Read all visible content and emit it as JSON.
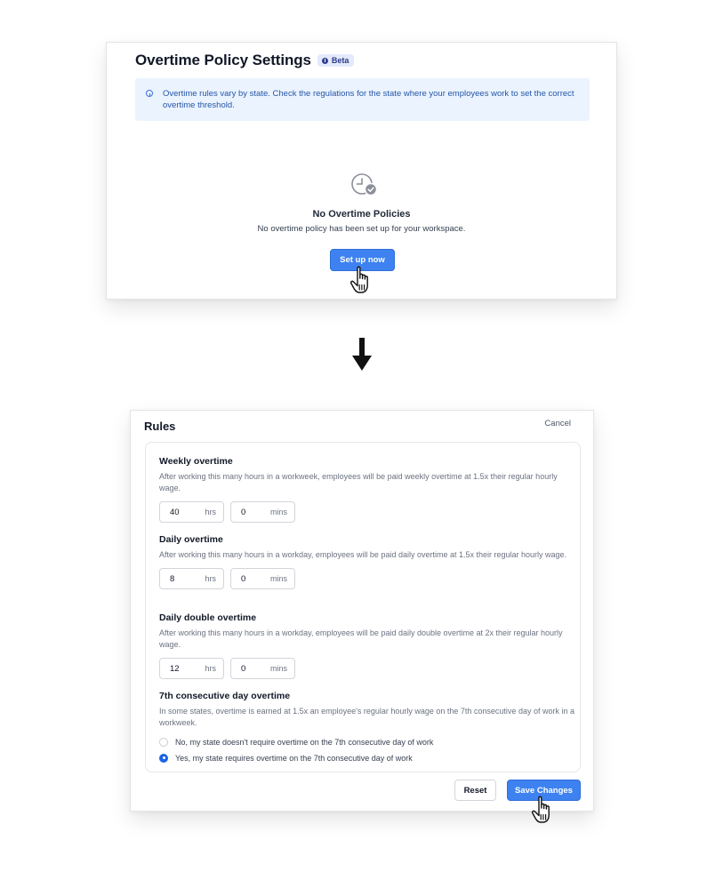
{
  "colors": {
    "primary": "#3d82f0",
    "notice_bg": "#eaf3fe",
    "notice_text": "#2756a8",
    "badge_bg": "#e4e9fb",
    "radio_checked": "#1d63e6"
  },
  "overtime_panel": {
    "title": "Overtime Policy Settings",
    "badge": "Beta",
    "badge_icon": "info-icon",
    "notice": {
      "icon": "info-circle-icon",
      "text": "Overtime rules vary by state. Check the regulations for the state where your employees work to set the correct overtime threshold."
    },
    "empty_state": {
      "icon": "clock-check-icon",
      "title": "No Overtime Policies",
      "subtitle": "No overtime policy has been set up for your workspace.",
      "button": "Set up now"
    }
  },
  "transition_icon": "arrow-down-icon",
  "rules_panel": {
    "title": "Rules",
    "cancel": "Cancel",
    "sections": {
      "weekly": {
        "title": "Weekly overtime",
        "description": "After working this many hours in a workweek, employees will be paid weekly overtime at 1.5x their regular hourly wage.",
        "hours": "40",
        "hours_unit": "hrs",
        "mins": "0",
        "mins_unit": "mins"
      },
      "daily": {
        "title": "Daily overtime",
        "description": "After working this many hours in a workday, employees will be paid daily overtime at 1.5x their regular hourly wage.",
        "hours": "8",
        "hours_unit": "hrs",
        "mins": "0",
        "mins_unit": "mins"
      },
      "double": {
        "title": "Daily double overtime",
        "description": "After working this many hours in a workday, employees will be paid daily double overtime at 2x their regular hourly wage.",
        "hours": "12",
        "hours_unit": "hrs",
        "mins": "0",
        "mins_unit": "mins"
      },
      "seventh": {
        "title": "7th consecutive day overtime",
        "description": "In some states, overtime is earned at 1.5x an employee's regular hourly wage on the 7th consecutive day of work in a workweek.",
        "options": [
          {
            "label": "No, my state doesn't require overtime on the 7th consecutive day of work",
            "selected": false
          },
          {
            "label": "Yes, my state requires overtime on the 7th consecutive day of work",
            "selected": true
          }
        ]
      }
    },
    "reset": "Reset",
    "save": "Save Changes"
  },
  "cursor_icon": "hand-pointer-icon"
}
